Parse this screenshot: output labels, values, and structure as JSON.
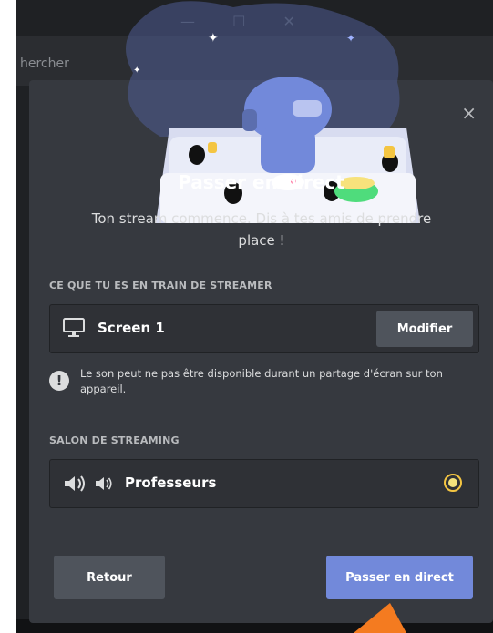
{
  "background": {
    "search_placeholder": "hercher"
  },
  "modal": {
    "close_label": "×",
    "title": "Passer en direct",
    "subtitle": "Ton stream commence. Dis à tes amis de prendre place !",
    "source_section": {
      "label": "CE QUE TU ES EN TRAIN DE STREAMER",
      "source_name": "Screen 1",
      "modify_label": "Modifier"
    },
    "warning": {
      "icon_text": "!",
      "text": "Le son peut ne pas être disponible durant un partage d'écran sur ton appareil."
    },
    "channel_section": {
      "label": "SALON DE STREAMING",
      "channel_name": "Professeurs"
    },
    "buttons": {
      "back": "Retour",
      "go_live": "Passer en direct"
    }
  },
  "colors": {
    "modal_bg": "#36393f",
    "box_bg": "#2f3136",
    "primary": "#7289da",
    "secondary": "#4f545c",
    "cursor": "#f47b20"
  }
}
